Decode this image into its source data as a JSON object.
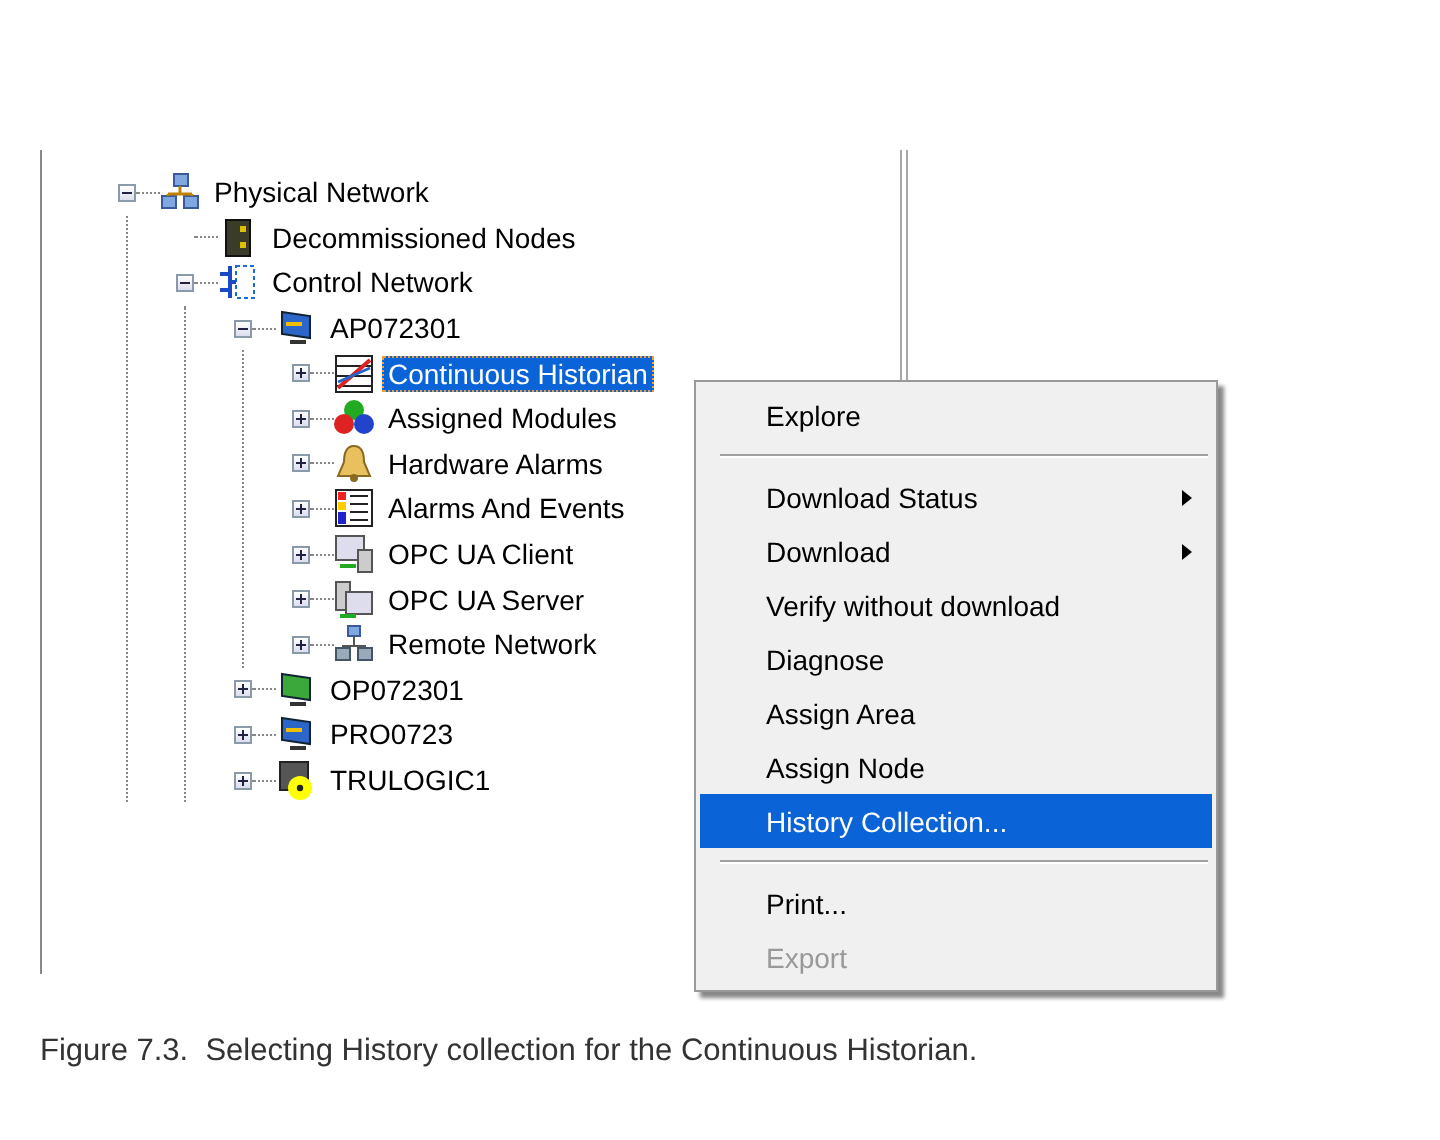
{
  "tree": [
    {
      "label": "Physical Network",
      "kind": "network",
      "expanded": true,
      "selected": false,
      "children": [
        {
          "label": "Decommissioned Nodes",
          "kind": "decommissioned",
          "selected": false
        },
        {
          "label": "Control Network",
          "kind": "controlnet",
          "expanded": true,
          "selected": false,
          "children": [
            {
              "label": "AP072301",
              "kind": "workstation",
              "expanded": true,
              "selected": false,
              "children": [
                {
                  "label": "Continuous Historian",
                  "kind": "historian",
                  "expanded": false,
                  "selected": true
                },
                {
                  "label": "Assigned Modules",
                  "kind": "modules",
                  "expanded": false,
                  "selected": false
                },
                {
                  "label": "Hardware Alarms",
                  "kind": "bell",
                  "expanded": false,
                  "selected": false
                },
                {
                  "label": "Alarms And Events",
                  "kind": "list",
                  "expanded": false,
                  "selected": false
                },
                {
                  "label": "OPC UA Client",
                  "kind": "opcclient",
                  "expanded": false,
                  "selected": false
                },
                {
                  "label": "OPC UA Server",
                  "kind": "opcserver",
                  "expanded": false,
                  "selected": false
                },
                {
                  "label": "Remote Network",
                  "kind": "remote",
                  "expanded": false,
                  "selected": false
                }
              ]
            },
            {
              "label": "OP072301",
              "kind": "operator",
              "expanded": false,
              "selected": false
            },
            {
              "label": "PRO0723",
              "kind": "workstation",
              "expanded": false,
              "selected": false
            },
            {
              "label": "TRULOGIC1",
              "kind": "unknown",
              "expanded": false,
              "selected": false
            }
          ]
        }
      ]
    }
  ],
  "context_menu": [
    {
      "kind": "item",
      "label": "Explore",
      "submenu": false,
      "selected": false,
      "disabled": false
    },
    {
      "kind": "separator"
    },
    {
      "kind": "item",
      "label": "Download Status",
      "submenu": true,
      "selected": false,
      "disabled": false
    },
    {
      "kind": "item",
      "label": "Download",
      "submenu": true,
      "selected": false,
      "disabled": false
    },
    {
      "kind": "item",
      "label": "Verify without download",
      "submenu": false,
      "selected": false,
      "disabled": false
    },
    {
      "kind": "item",
      "label": "Diagnose",
      "submenu": false,
      "selected": false,
      "disabled": false
    },
    {
      "kind": "item",
      "label": "Assign Area",
      "submenu": false,
      "selected": false,
      "disabled": false
    },
    {
      "kind": "item",
      "label": "Assign Node",
      "submenu": false,
      "selected": false,
      "disabled": false
    },
    {
      "kind": "item",
      "label": "History Collection...",
      "submenu": false,
      "selected": true,
      "disabled": false
    },
    {
      "kind": "separator"
    },
    {
      "kind": "item",
      "label": "Print...",
      "submenu": false,
      "selected": false,
      "disabled": false
    },
    {
      "kind": "item",
      "label": "Export",
      "submenu": false,
      "selected": false,
      "disabled": true
    }
  ],
  "caption": "Figure 7.3.  Selecting History collection for the Continuous Historian."
}
